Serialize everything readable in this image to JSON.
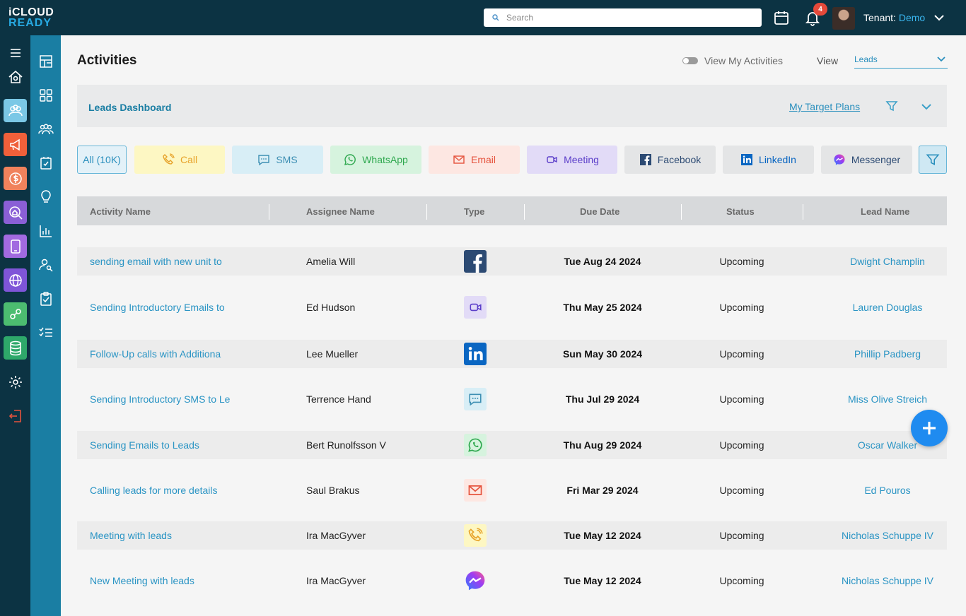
{
  "app": {
    "logo_top": "iCLOUD",
    "logo_bottom": "READY"
  },
  "topbar": {
    "search_placeholder": "Search",
    "notification_count": "4",
    "tenant_label": "Tenant:",
    "tenant_value": "Demo"
  },
  "page": {
    "title": "Activities",
    "view_my_activities": "View My Activities",
    "view_label": "View",
    "view_value": "Leads"
  },
  "dashboard": {
    "title": "Leads Dashboard",
    "link": "My Target Plans"
  },
  "chips": [
    {
      "label": "All (10K)",
      "icon": "none",
      "bg": "#e3f1f8",
      "fg": "#2a8fbd"
    },
    {
      "label": "Call",
      "icon": "phone-icon",
      "bg": "#fdf7c3",
      "fg": "#e7a32a"
    },
    {
      "label": "SMS",
      "icon": "chat-icon",
      "bg": "#d8eef6",
      "fg": "#3d8fb3"
    },
    {
      "label": "WhatsApp",
      "icon": "whatsapp-icon",
      "bg": "#d6f3de",
      "fg": "#2fa84f"
    },
    {
      "label": "Email",
      "icon": "mail-icon",
      "bg": "#fde7e2",
      "fg": "#e5533d"
    },
    {
      "label": "Meeting",
      "icon": "video-icon",
      "bg": "#e2dbf7",
      "fg": "#5b3ec9"
    },
    {
      "label": "Facebook",
      "icon": "facebook-icon",
      "bg": "#e4e5e6",
      "fg": "#2c4a73"
    },
    {
      "label": "LinkedIn",
      "icon": "linkedin-icon",
      "bg": "#e4e5e6",
      "fg": "#0a66c2"
    },
    {
      "label": "Messenger",
      "icon": "messenger-icon",
      "bg": "#e4e5e6",
      "fg": "#2c4a73"
    }
  ],
  "table": {
    "headers": [
      "Activity Name",
      "Assignee Name",
      "Type",
      "Due Date",
      "Status",
      "Lead Name"
    ],
    "rows": [
      {
        "name": "sending email with new unit to",
        "assignee": "Amelia Will",
        "type": "facebook-icon",
        "date": "Tue Aug 24 2024",
        "status": "Upcoming",
        "lead": "Dwight Champlin"
      },
      {
        "name": "Sending Introductory Emails to",
        "assignee": "Ed Hudson",
        "type": "video-icon",
        "date": "Thu May 25 2024",
        "status": "Upcoming",
        "lead": "Lauren Douglas"
      },
      {
        "name": "Follow-Up calls with Additiona",
        "assignee": "Lee Mueller",
        "type": "linkedin-icon",
        "date": "Sun May 30 2024",
        "status": "Upcoming",
        "lead": "Phillip Padberg"
      },
      {
        "name": "Sending Introductory SMS to Le",
        "assignee": "Terrence Hand",
        "type": "chat-icon",
        "date": "Thu Jul 29 2024",
        "status": "Upcoming",
        "lead": "Miss Olive Streich"
      },
      {
        "name": "Sending  Emails to Leads",
        "assignee": "Bert Runolfsson V",
        "type": "whatsapp-icon",
        "date": "Thu Aug 29 2024",
        "status": "Upcoming",
        "lead": "Oscar Walker"
      },
      {
        "name": "Calling leads for more details",
        "assignee": "Saul Brakus",
        "type": "mail-icon",
        "date": "Fri Mar 29 2024",
        "status": "Upcoming",
        "lead": "Ed Pouros"
      },
      {
        "name": "Meeting with leads",
        "assignee": "Ira MacGyver",
        "type": "phone-icon",
        "date": "Tue May 12 2024",
        "status": "Upcoming",
        "lead": "Nicholas Schuppe IV"
      },
      {
        "name": "New Meeting with leads",
        "assignee": "Ira MacGyver",
        "type": "messenger-icon",
        "date": "Tue May 12 2024",
        "status": "Upcoming",
        "lead": "Nicholas Schuppe IV"
      }
    ]
  }
}
